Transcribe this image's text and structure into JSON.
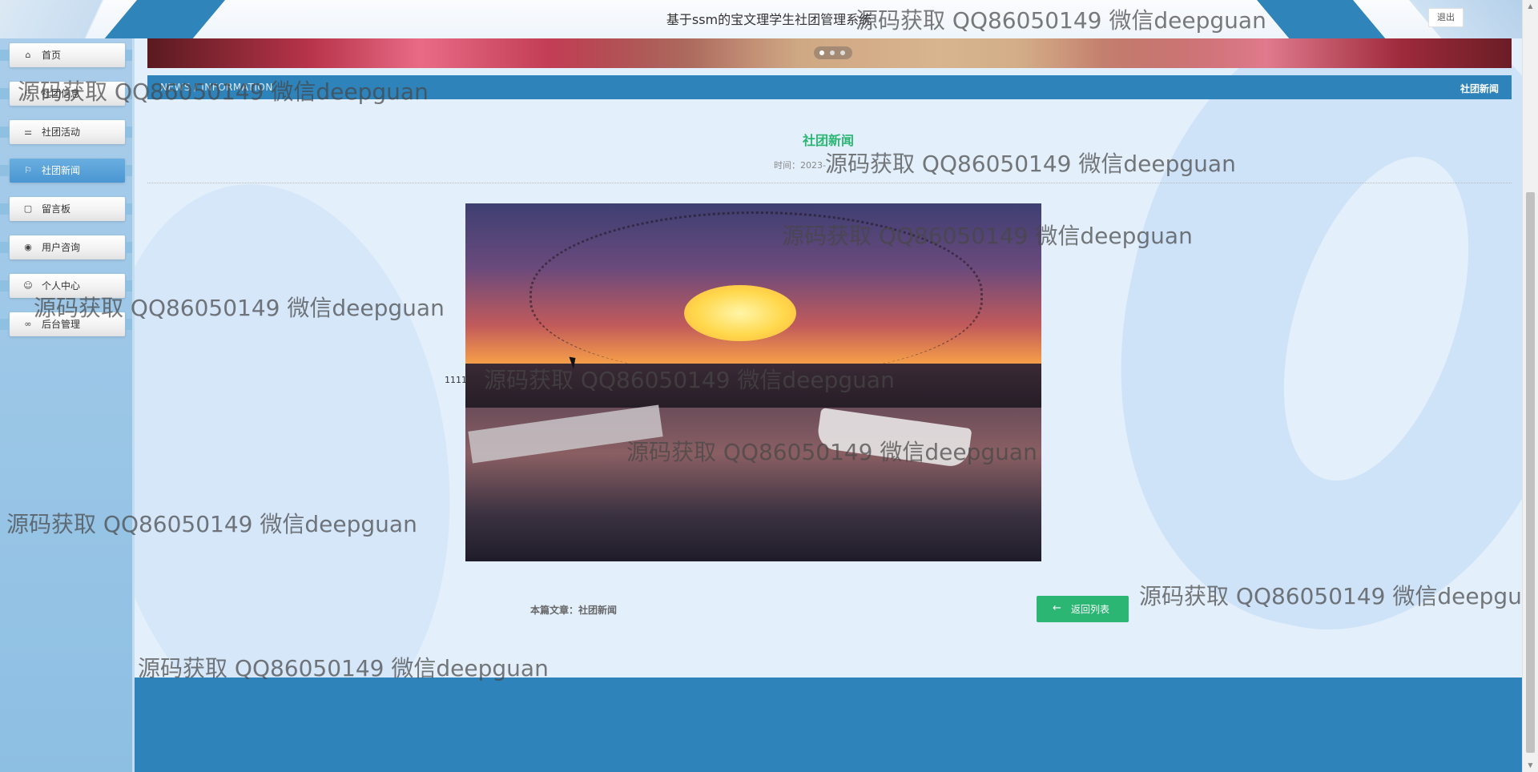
{
  "header": {
    "site_title": "基于ssm的宝文理学生社团管理系统",
    "logout_label": "退出"
  },
  "sidebar": {
    "items": [
      {
        "label": "首页",
        "icon": "home-icon"
      },
      {
        "label": "社团信息",
        "icon": "people-icon"
      },
      {
        "label": "社团活动",
        "icon": "activity-icon"
      },
      {
        "label": "社团新闻",
        "icon": "flag-icon",
        "active": true
      },
      {
        "label": "留言板",
        "icon": "note-icon"
      },
      {
        "label": "用户咨询",
        "icon": "chat-icon"
      },
      {
        "label": "个人中心",
        "icon": "user-icon"
      },
      {
        "label": "后台管理",
        "icon": "link-icon"
      }
    ]
  },
  "banner": {
    "slides": 3,
    "active_slide": 1
  },
  "news_bar": {
    "english_label": "NEWS / INFORMATION",
    "current_label": "社团新闻"
  },
  "article": {
    "title": "社团新闻",
    "meta": "时间：2023-",
    "content_text": "1111",
    "footer_label": "本篇文章：",
    "footer_value": "社团新闻",
    "back_button_label": "返回列表"
  },
  "watermark": "源码获取 QQ86050149 微信deepguan",
  "colors": {
    "primary_blue": "#2e83bb",
    "accent_green": "#2bb673",
    "sidebar_blue": "#8dbfe3",
    "page_bg": "#e3effb"
  }
}
